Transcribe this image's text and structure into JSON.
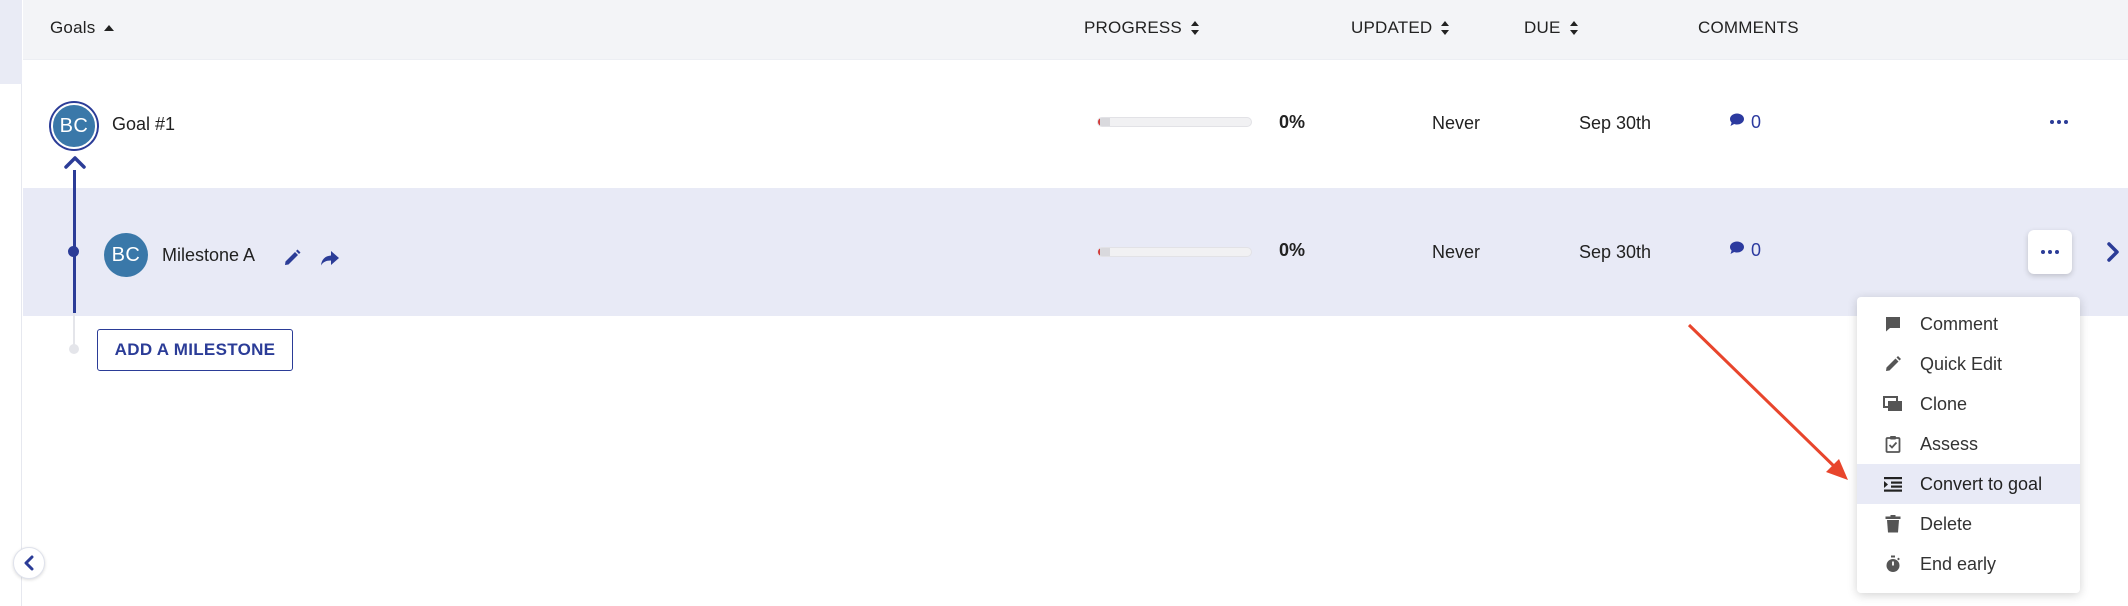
{
  "header": {
    "goals": "Goals",
    "progress": "PROGRESS",
    "updated": "UPDATED",
    "due": "DUE",
    "comments": "COMMENTS"
  },
  "goal": {
    "avatar": "BC",
    "title": "Goal #1",
    "progress_pct": "0%",
    "progress_fraction": 0,
    "updated": "Never",
    "due": "Sep 30th",
    "comments": "0"
  },
  "milestone": {
    "avatar": "BC",
    "title": "Milestone A",
    "progress_pct": "0%",
    "progress_fraction": 0,
    "updated": "Never",
    "due": "Sep 30th",
    "comments": "0"
  },
  "add_milestone_label": "ADD A MILESTONE",
  "menu": {
    "items": [
      {
        "label": "Comment",
        "icon": "comment-icon"
      },
      {
        "label": "Quick Edit",
        "icon": "pencil-icon"
      },
      {
        "label": "Clone",
        "icon": "clone-icon"
      },
      {
        "label": "Assess",
        "icon": "clipboard-check-icon"
      },
      {
        "label": "Convert to goal",
        "icon": "convert-list-icon",
        "active": true
      },
      {
        "label": "Delete",
        "icon": "trash-icon"
      },
      {
        "label": "End early",
        "icon": "stopwatch-icon"
      }
    ]
  },
  "colors": {
    "accent": "#2b3c97",
    "avatar": "#3a78a9",
    "selected_row": "#e8eaf6",
    "annotation_arrow": "#e8452c"
  }
}
